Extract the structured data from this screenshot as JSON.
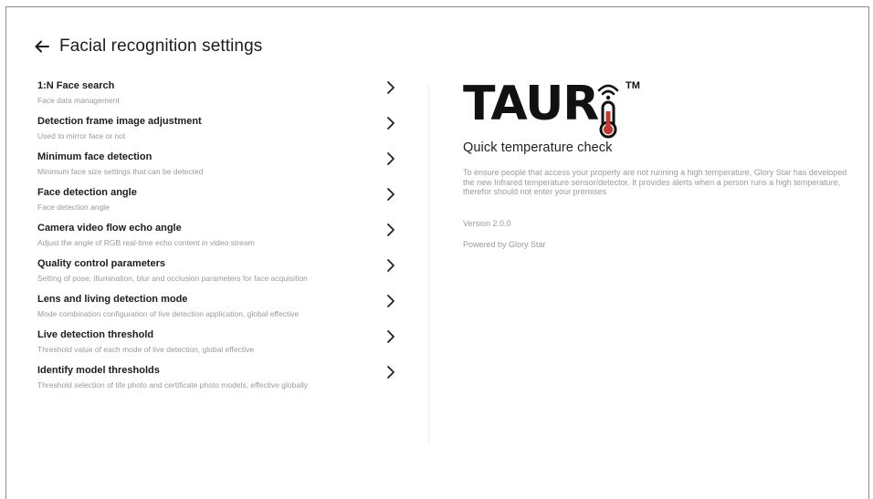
{
  "header": {
    "title": "Facial recognition settings",
    "back_icon": "arrow-left-icon"
  },
  "settings": [
    {
      "title": "1:N Face search",
      "subtitle": "Face data management"
    },
    {
      "title": "Detection frame image adjustment",
      "subtitle": "Used to mirror face or not"
    },
    {
      "title": "Minimum face detection",
      "subtitle": "Minimum face size settings that can be detected"
    },
    {
      "title": "Face detection angle",
      "subtitle": "Face detection angle"
    },
    {
      "title": "Camera video flow echo angle",
      "subtitle": "Adjust the angle of RGB real-time echo content in video stream"
    },
    {
      "title": "Quality control parameters",
      "subtitle": "Setting of pose, illumination, blur and occlusion parameters for face acquisition"
    },
    {
      "title": "Lens and living detection mode",
      "subtitle": "Mode combination configuration of live detection application, global effective"
    },
    {
      "title": "Live detection threshold",
      "subtitle": "Threshold value of each mode of live detection, global effective"
    },
    {
      "title": "Identify model thresholds",
      "subtitle": "Threshold selection of life photo and certificate photo models, effective globally"
    }
  ],
  "brand": {
    "logo_text": "TAUR",
    "trademark": "TM",
    "tagline": "Quick temperature check",
    "description": "To ensure people that access your property are not running a high temperature, Glory Star has developed the new Infrared temperature sensor/detector. It provides alerts when a person runs a high temperature, therefor should not enter your premises",
    "version": "Version 2.0.0",
    "powered_by": "Powered by Glory Star",
    "accent_color": "#c0392b"
  }
}
